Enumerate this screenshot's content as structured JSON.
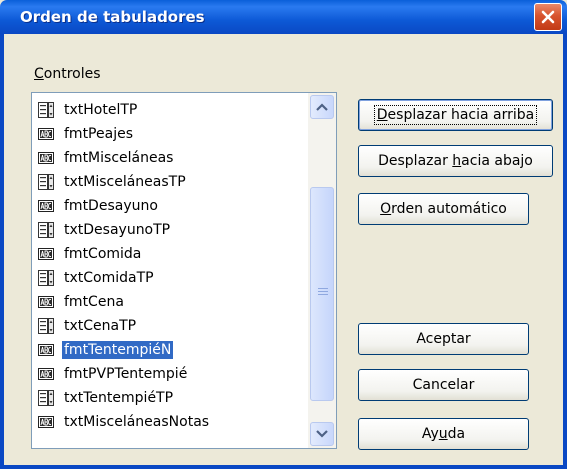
{
  "window": {
    "title": "Orden de tabuladores",
    "close_label": "close"
  },
  "controls_label": {
    "mnemonic": "C",
    "rest": "ontroles"
  },
  "list": {
    "items": [
      {
        "icon": "textfield-icon",
        "label": "txtHotelTP"
      },
      {
        "icon": "label-field-icon",
        "label": "fmtPeajes"
      },
      {
        "icon": "label-field-icon",
        "label": "fmtMisceláneas"
      },
      {
        "icon": "textfield-icon",
        "label": "txtMisceláneasTP"
      },
      {
        "icon": "label-field-icon",
        "label": "fmtDesayuno"
      },
      {
        "icon": "textfield-icon",
        "label": "txtDesayunoTP"
      },
      {
        "icon": "label-field-icon",
        "label": "fmtComida"
      },
      {
        "icon": "textfield-icon",
        "label": "txtComidaTP"
      },
      {
        "icon": "label-field-icon",
        "label": "fmtCena"
      },
      {
        "icon": "textfield-icon",
        "label": "txtCenaTP"
      },
      {
        "icon": "label-field-icon",
        "label": "fmtTentempiéN",
        "selected": true
      },
      {
        "icon": "label-field-icon",
        "label": "fmtPVPTentempié"
      },
      {
        "icon": "textfield-icon",
        "label": "txtTentempiéTP"
      },
      {
        "icon": "label-field-icon",
        "label": "txtMisceláneasNotas"
      }
    ],
    "selected_index": 10
  },
  "buttons": {
    "move_up": {
      "before": "",
      "mnemonic": "D",
      "after": "esplazar hacia arriba"
    },
    "move_down": {
      "before": "Desplazar ",
      "mnemonic": "h",
      "after": "acia abajo"
    },
    "auto_order": {
      "before": "",
      "mnemonic": "O",
      "after": "rden automático"
    },
    "accept": {
      "label": "Aceptar"
    },
    "cancel": {
      "label": "Cancelar"
    },
    "help": {
      "before": "Ay",
      "mnemonic": "u",
      "after": "da"
    }
  },
  "colors": {
    "titlebar": "#0a5fd9",
    "dialog_bg": "#ece9d8",
    "selection": "#316ac5",
    "close_button": "#d8532e"
  }
}
